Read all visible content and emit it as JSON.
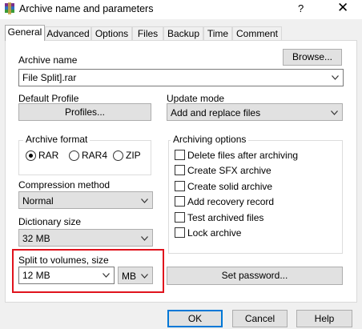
{
  "window": {
    "title": "Archive name and parameters",
    "help_glyph": "?",
    "close_glyph": "✕"
  },
  "tabs": [
    {
      "label": "General",
      "active": true
    },
    {
      "label": "Advanced"
    },
    {
      "label": "Options"
    },
    {
      "label": "Files"
    },
    {
      "label": "Backup"
    },
    {
      "label": "Time"
    },
    {
      "label": "Comment"
    }
  ],
  "general": {
    "archive_name_label": "Archive name",
    "browse_label": "Browse...",
    "archive_name_value": "File Split].rar",
    "default_profile_label": "Default Profile",
    "profiles_label": "Profiles...",
    "update_mode_label": "Update mode",
    "update_mode_value": "Add and replace files",
    "archive_format_label": "Archive format",
    "formats": [
      "RAR",
      "RAR4",
      "ZIP"
    ],
    "selected_format": "RAR",
    "compression_method_label": "Compression method",
    "compression_method_value": "Normal",
    "dictionary_size_label": "Dictionary size",
    "dictionary_size_value": "32 MB",
    "split_label": "Split to volumes, size",
    "split_value": "12 MB",
    "split_unit": "MB",
    "archiving_options_label": "Archiving options",
    "options": [
      {
        "label": "Delete files after archiving",
        "checked": false
      },
      {
        "label": "Create SFX archive",
        "checked": false
      },
      {
        "label": "Create solid archive",
        "checked": false
      },
      {
        "label": "Add recovery record",
        "checked": false
      },
      {
        "label": "Test archived files",
        "checked": false
      },
      {
        "label": "Lock archive",
        "checked": false
      }
    ],
    "set_password_label": "Set password..."
  },
  "buttons": {
    "ok": "OK",
    "cancel": "Cancel",
    "help": "Help"
  },
  "colors": {
    "highlight": "#e0131d",
    "default_button_border": "#0078d7"
  }
}
